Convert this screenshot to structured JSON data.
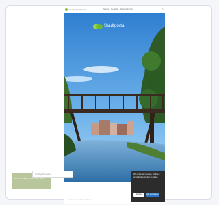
{
  "topbar": {
    "site_name": "Landeshauptstadt",
    "center_links": "Suche · Kontakt · Barrierefreiheit",
    "menu_icon": "hamburger-icon"
  },
  "brand": {
    "name": "Stadtportal"
  },
  "hero": {
    "scene": "wooden-bridge-over-river",
    "colors": {
      "sky": "#6fb3ea",
      "water": "#4a89bf",
      "trees": "#2f5a27"
    }
  },
  "search": {
    "placeholder": "Suchbegriff eingeben ..."
  },
  "promo": {
    "text": "Herzlich willkommen in der Stadt"
  },
  "cookie": {
    "text": "Wir verwenden Cookies, um Ihnen ein optimales Erlebnis zu bieten.",
    "decline_label": "Ablehnen",
    "accept_label": "Alle akzeptieren"
  },
  "footer": {
    "text": "Impressum · Datenschutz"
  }
}
